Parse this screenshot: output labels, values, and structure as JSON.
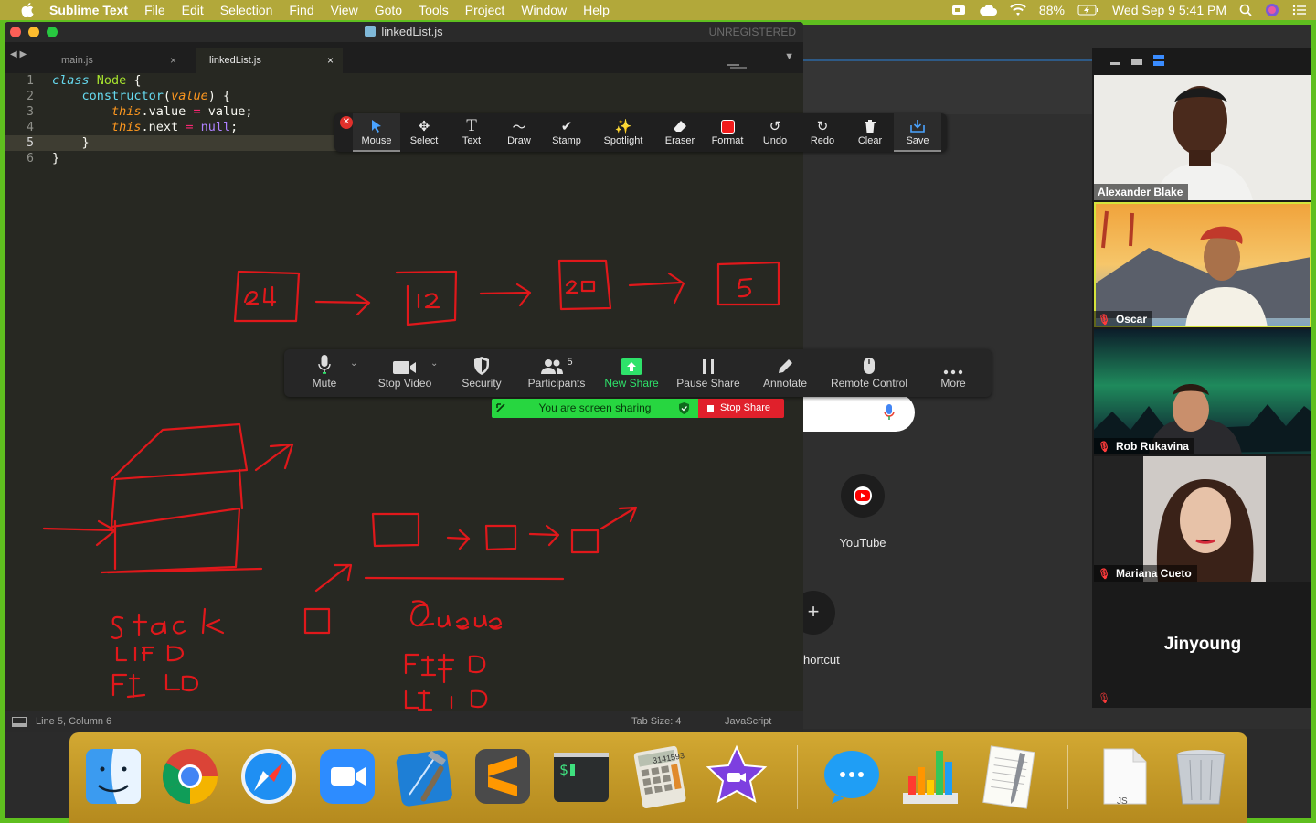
{
  "menubar": {
    "app": "Sublime Text",
    "items": [
      "File",
      "Edit",
      "Selection",
      "Find",
      "View",
      "Goto",
      "Tools",
      "Project",
      "Window",
      "Help"
    ],
    "battery": "88%",
    "clock": "Wed Sep 9  5:41 PM"
  },
  "sublime": {
    "title": "linkedList.js",
    "unregistered": "UNREGISTERED",
    "tabs": [
      {
        "label": "main.js",
        "close": "×"
      },
      {
        "label": "linkedList.js",
        "close": "×"
      }
    ],
    "line_numbers": [
      "1",
      "2",
      "3",
      "4",
      "5",
      "6"
    ],
    "status": {
      "position": "Line 5, Column 6",
      "tab_size": "Tab Size: 4",
      "syntax": "JavaScript"
    }
  },
  "annotate_toolbar": {
    "tools": [
      "Mouse",
      "Select",
      "Text",
      "Draw",
      "Stamp",
      "Spotlight",
      "Eraser",
      "Format",
      "Undo",
      "Redo",
      "Clear",
      "Save"
    ]
  },
  "zoom_toolbar": {
    "buttons": [
      "Mute",
      "Stop Video",
      "Security",
      "Participants",
      "New Share",
      "Pause Share",
      "Annotate",
      "Remote Control",
      "More"
    ],
    "participant_count": "5",
    "sharing_text": "You are screen sharing",
    "stop_share": "Stop Share"
  },
  "browser": {
    "shortcuts": [
      {
        "label": "YouTube"
      },
      {
        "label": "hortcut"
      }
    ]
  },
  "gallery": {
    "participants": [
      {
        "name": "Alexander Blake"
      },
      {
        "name": "Oscar"
      },
      {
        "name": "Rob Rukavina"
      },
      {
        "name": "Mariana Cueto"
      },
      {
        "name": "Jinyoung"
      }
    ]
  },
  "dock": {
    "apps": [
      "finder",
      "chrome",
      "safari",
      "zoom",
      "xcode",
      "sublime-text",
      "terminal",
      "calculator",
      "imovie",
      "messages",
      "numbers",
      "textedit",
      "js-file",
      "trash"
    ],
    "calculator_display": "3141593",
    "js_file_label": "JS"
  },
  "colors": {
    "border_green": "#5fbf1f",
    "annotation_red": "#e0181b",
    "zoom_green": "#2ee26a",
    "stop_red": "#e0202b"
  }
}
